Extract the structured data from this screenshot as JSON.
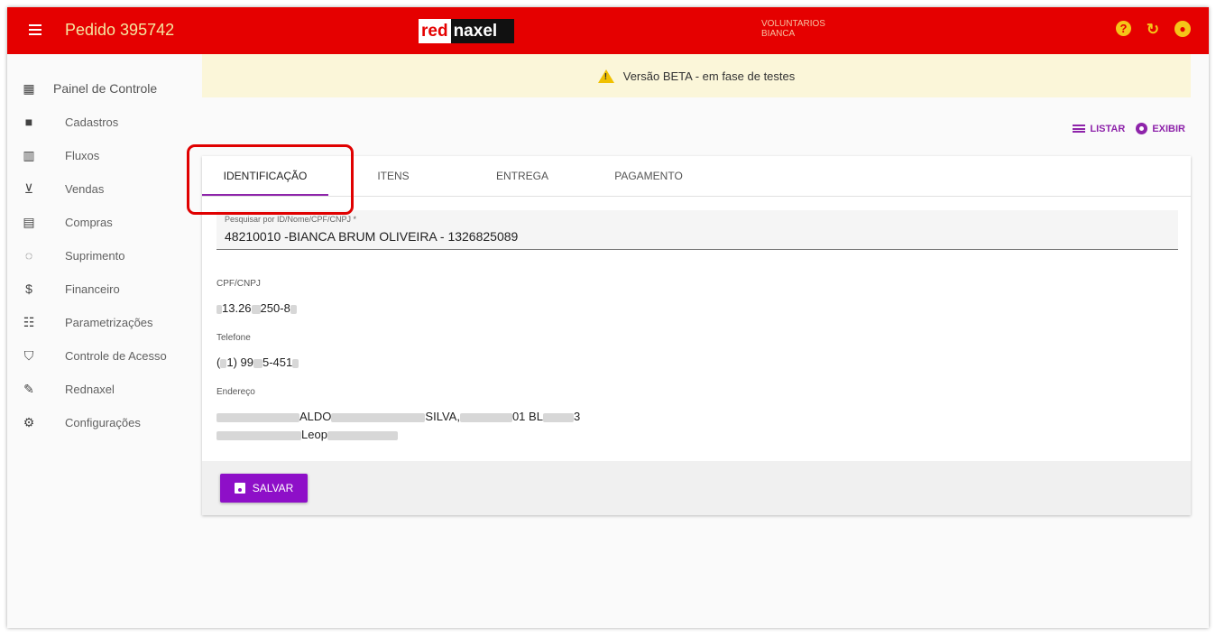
{
  "header": {
    "title": "Pedido 395742",
    "logo_red": "red",
    "logo_naxel": "naxel",
    "user_line1": "VOLUNTARIOS",
    "user_line2": "BIANCA",
    "icons": [
      "menu-icon",
      "help-icon",
      "refresh-icon",
      "account-icon"
    ]
  },
  "sidebar": {
    "items": [
      {
        "label": "Painel de Controle",
        "icon": "dashboard-icon"
      },
      {
        "label": "Cadastros",
        "icon": "folder-icon"
      },
      {
        "label": "Fluxos",
        "icon": "columns-icon"
      },
      {
        "label": "Vendas",
        "icon": "cart-icon"
      },
      {
        "label": "Compras",
        "icon": "building-icon"
      },
      {
        "label": "Suprimento",
        "icon": "supply-icon"
      },
      {
        "label": "Financeiro",
        "icon": "dollar-icon"
      },
      {
        "label": "Parametrizações",
        "icon": "sliders-icon"
      },
      {
        "label": "Controle de Acesso",
        "icon": "shield-icon"
      },
      {
        "label": "Rednaxel",
        "icon": "wrench-icon"
      },
      {
        "label": "Configurações",
        "icon": "gear-icon"
      }
    ]
  },
  "banner": {
    "text": "Versão BETA - em fase de testes"
  },
  "actions": {
    "list_label": "LISTAR",
    "view_label": "EXIBIR"
  },
  "tabs": [
    {
      "label": "IDENTIFICAÇÃO",
      "active": true
    },
    {
      "label": "ITENS",
      "active": false
    },
    {
      "label": "ENTREGA",
      "active": false
    },
    {
      "label": "PAGAMENTO",
      "active": false
    }
  ],
  "form": {
    "search_label": "Pesquisar por ID/Nome/CPF/CNPJ *",
    "search_value": "48210010 -BIANCA BRUM OLIVEIRA - 1326825089",
    "cpf_label": "CPF/CNPJ",
    "cpf_value_a": "13.26",
    "cpf_value_b": "250-8",
    "phone_label": "Telefone",
    "phone_value_a": "(",
    "phone_value_b": "1) 99",
    "phone_value_c": "5-451",
    "address_label": "Endereço",
    "address_line1_a": "ALDO",
    "address_line1_b": "SILVA,",
    "address_line1_c": "01 BL",
    "address_line1_d": "3",
    "address_line2_a": "Leop"
  },
  "footer": {
    "save_label": "SALVAR"
  },
  "colors": {
    "topbar": "#e50000",
    "accent": "#8e24aa",
    "save_button": "#8e0fc8",
    "banner_bg": "#fbf6d9",
    "title_text": "#f5e6a0"
  }
}
